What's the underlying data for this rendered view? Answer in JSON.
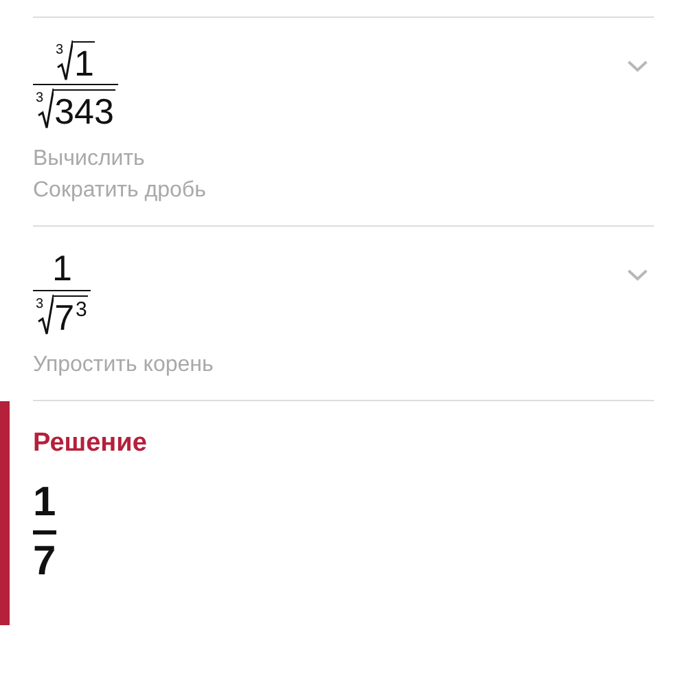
{
  "steps": [
    {
      "expression": {
        "numerator": {
          "kind": "radical",
          "index": "3",
          "radicand": "1"
        },
        "denominator": {
          "kind": "radical",
          "index": "3",
          "radicand": "343"
        }
      },
      "expanded": false,
      "actions": [
        "Вычислить",
        "Сократить дробь"
      ]
    },
    {
      "expression": {
        "numerator": {
          "kind": "number",
          "text": "1"
        },
        "denominator": {
          "kind": "radical",
          "index": "3",
          "radicand": "7",
          "exponent": "3"
        }
      },
      "expanded": false,
      "actions": [
        "Упростить корень"
      ]
    }
  ],
  "solution": {
    "title": "Решение",
    "answer": {
      "numerator": "1",
      "denominator": "7"
    }
  }
}
